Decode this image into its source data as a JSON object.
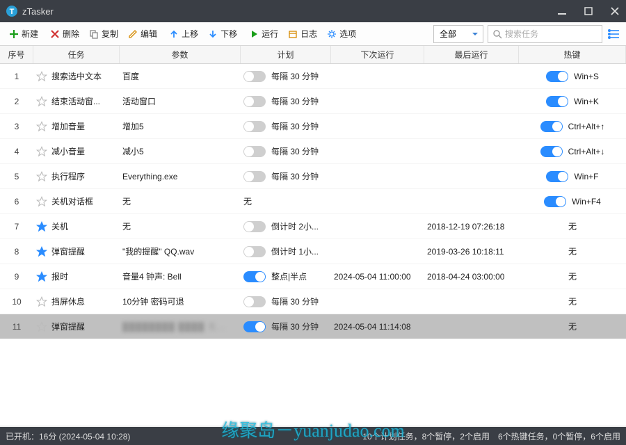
{
  "app": {
    "title": "zTasker"
  },
  "toolbar": {
    "new": "新建",
    "delete": "删除",
    "copy": "复制",
    "edit": "编辑",
    "moveUp": "上移",
    "moveDown": "下移",
    "run": "运行",
    "log": "日志",
    "opts": "选项",
    "filter": "全部",
    "search_ph": "搜索任务"
  },
  "columns": {
    "idx": "序号",
    "task": "任务",
    "param": "参数",
    "plan": "计划",
    "next": "下次运行",
    "last": "最后运行",
    "hot": "热键"
  },
  "rows": [
    {
      "idx": 1,
      "fav": false,
      "task": "搜索选中文本",
      "param": "百度",
      "plan_on": false,
      "plan": "每隔 30 分钟",
      "next": "",
      "last": "",
      "hot_on": true,
      "hot": "Win+S"
    },
    {
      "idx": 2,
      "fav": false,
      "task": "结束活动窗...",
      "param": "活动窗口",
      "plan_on": false,
      "plan": "每隔 30 分钟",
      "next": "",
      "last": "",
      "hot_on": true,
      "hot": "Win+K"
    },
    {
      "idx": 3,
      "fav": false,
      "task": "增加音量",
      "param": "增加5",
      "plan_on": false,
      "plan": "每隔 30 分钟",
      "next": "",
      "last": "",
      "hot_on": true,
      "hot": "Ctrl+Alt+↑"
    },
    {
      "idx": 4,
      "fav": false,
      "task": "减小音量",
      "param": "减小5",
      "plan_on": false,
      "plan": "每隔 30 分钟",
      "next": "",
      "last": "",
      "hot_on": true,
      "hot": "Ctrl+Alt+↓"
    },
    {
      "idx": 5,
      "fav": false,
      "task": "执行程序",
      "param": "Everything.exe",
      "plan_on": false,
      "plan": "每隔 30 分钟",
      "next": "",
      "last": "",
      "hot_on": true,
      "hot": "Win+F"
    },
    {
      "idx": 6,
      "fav": false,
      "task": "关机对话框",
      "param": "无",
      "plan_on": null,
      "plan": "无",
      "next": "",
      "last": "",
      "hot_on": true,
      "hot": "Win+F4"
    },
    {
      "idx": 7,
      "fav": true,
      "task": "关机",
      "param": "无",
      "plan_on": false,
      "plan": "倒计时 2小...",
      "next": "",
      "last": "2018-12-19 07:26:18",
      "hot_on": null,
      "hot": "无"
    },
    {
      "idx": 8,
      "fav": true,
      "task": "弹窗提醒",
      "param": "\"我的提醒\" QQ.wav",
      "plan_on": false,
      "plan": "倒计时 1小...",
      "next": "",
      "last": "2019-03-26 10:18:11",
      "hot_on": null,
      "hot": "无"
    },
    {
      "idx": 9,
      "fav": true,
      "task": "报时",
      "param": "音量4 钟声: Bell",
      "plan_on": true,
      "plan": "整点|半点",
      "next": "2024-05-04 11:00:00",
      "last": "2018-04-24 03:00:00",
      "hot_on": null,
      "hot": "无"
    },
    {
      "idx": 10,
      "fav": false,
      "task": "挡屏休息",
      "param": "10分钟 密码可退",
      "plan_on": false,
      "plan": "每隔 30 分钟",
      "next": "",
      "last": "",
      "hot_on": null,
      "hot": "无"
    },
    {
      "idx": 11,
      "fav": false,
      "task": "弹窗提醒",
      "param": "████████ ████ 无...",
      "param_blur": true,
      "plan_on": true,
      "plan": "每隔 30 分钟",
      "next": "2024-05-04 11:14:08",
      "last": "",
      "hot_on": null,
      "hot": "无",
      "selected": true
    }
  ],
  "status": {
    "left": "已开机：16分 (2024-05-04 10:28)",
    "right": "10个计划任务，8个暂停，2个启用　6个热键任务，0个暂停，6个启用"
  },
  "watermark": "缘聚岛－yuanjudao.com"
}
